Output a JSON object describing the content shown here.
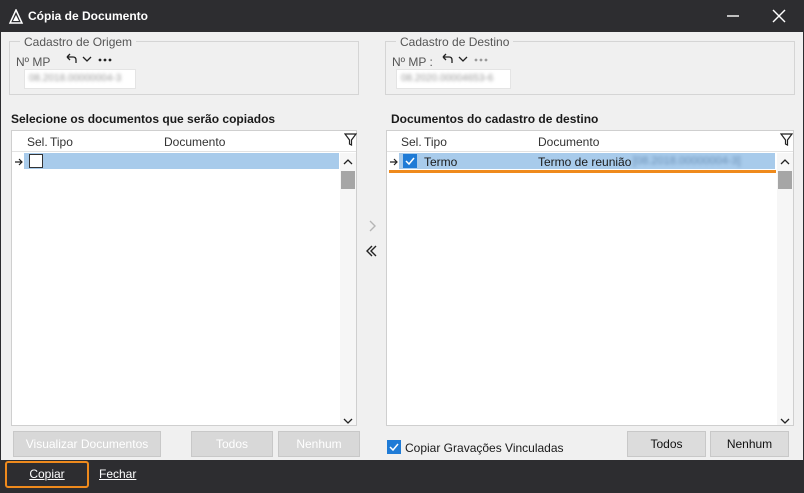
{
  "window": {
    "title": "Cópia de Documento"
  },
  "origem": {
    "legend": "Cadastro de Origem",
    "mp_label": "Nº MP",
    "mp_value": "08.2018.00000004-3"
  },
  "destino": {
    "legend": "Cadastro de Destino",
    "mp_label": "Nº MP :",
    "mp_value": "08.2020.00004653-6"
  },
  "left_panel": {
    "title": "Selecione os documentos que serão copiados",
    "columns": [
      "Sel.",
      "Tipo",
      "Documento"
    ],
    "buttons": {
      "view": "Visualizar Documentos",
      "all": "Todos",
      "none": "Nenhum"
    }
  },
  "right_panel": {
    "title": "Documentos do cadastro de destino",
    "columns": [
      "Sel.",
      "Tipo",
      "Documento"
    ],
    "rows": [
      {
        "tipo": "Termo",
        "documento": "Termo de reunião",
        "documento_extra": "[08.2018.00000004-3]"
      }
    ],
    "copy_linked_label": "Copiar Gravações Vinculadas",
    "buttons": {
      "all": "Todos",
      "none": "Nenhum"
    }
  },
  "footer": {
    "copy_label": "Copiar",
    "close_label": "Fechar"
  },
  "colors": {
    "accent": "#ef8a1c",
    "selection": "#a8cbeb",
    "check": "#1f7bd6"
  }
}
